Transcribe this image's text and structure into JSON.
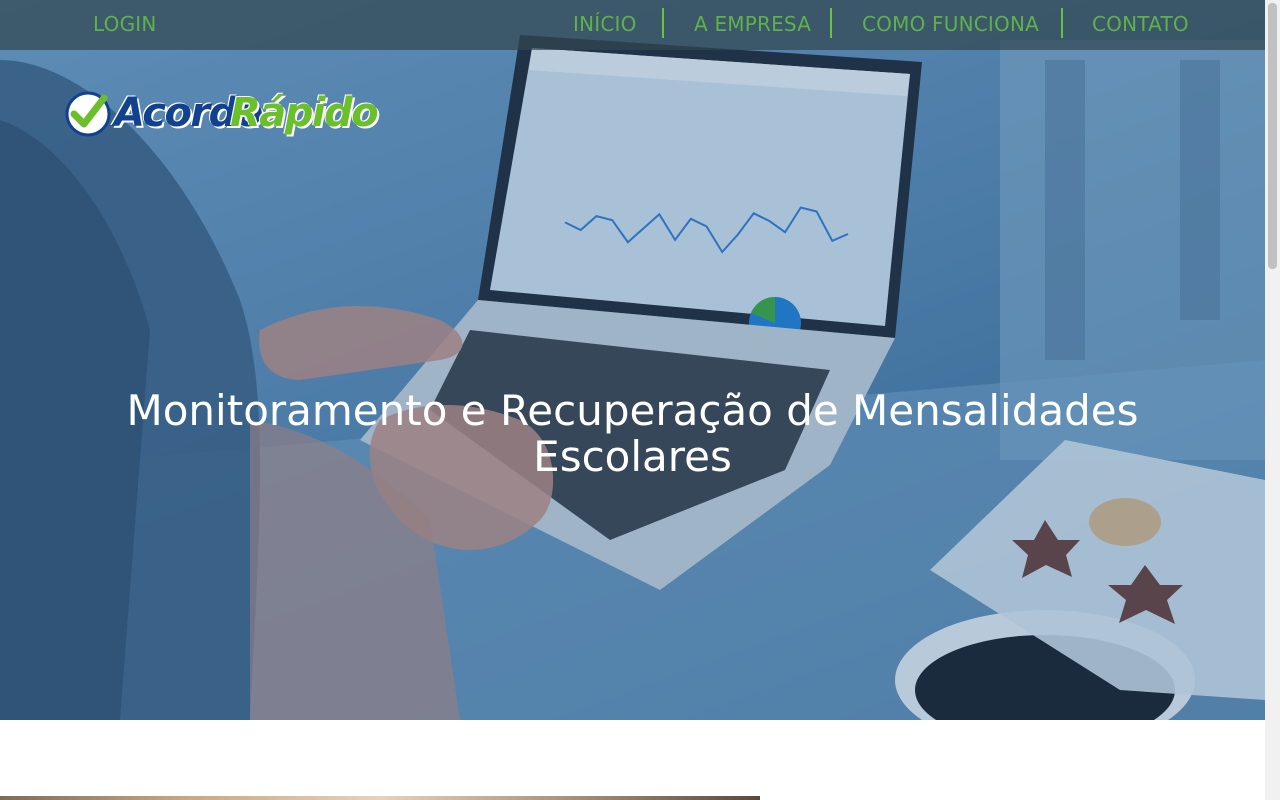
{
  "nav": {
    "login": "LOGIN",
    "items": [
      "INÍCIO",
      "A EMPRESA",
      "COMO FUNCIONA",
      "CONTATO"
    ]
  },
  "logo": {
    "word1": "Acordo",
    "word2": "Rápido",
    "icon": "checkmark-icon"
  },
  "hero": {
    "title": "Monitoramento e Recuperação de Mensalidades Escolares",
    "laptop_chart": {
      "type": "line",
      "values": [
        62,
        58,
        66,
        64,
        52,
        60,
        68,
        54,
        66,
        62,
        48,
        58,
        70,
        66,
        60,
        74,
        72,
        56,
        60
      ]
    },
    "pie": {
      "slices": [
        0.28,
        0.72
      ],
      "colors": [
        "#3aa83a",
        "#1e7fd6"
      ]
    }
  },
  "colors": {
    "accent_green": "#5fb14a",
    "logo_blue": "#12418e",
    "logo_green": "#6bbf2a"
  }
}
